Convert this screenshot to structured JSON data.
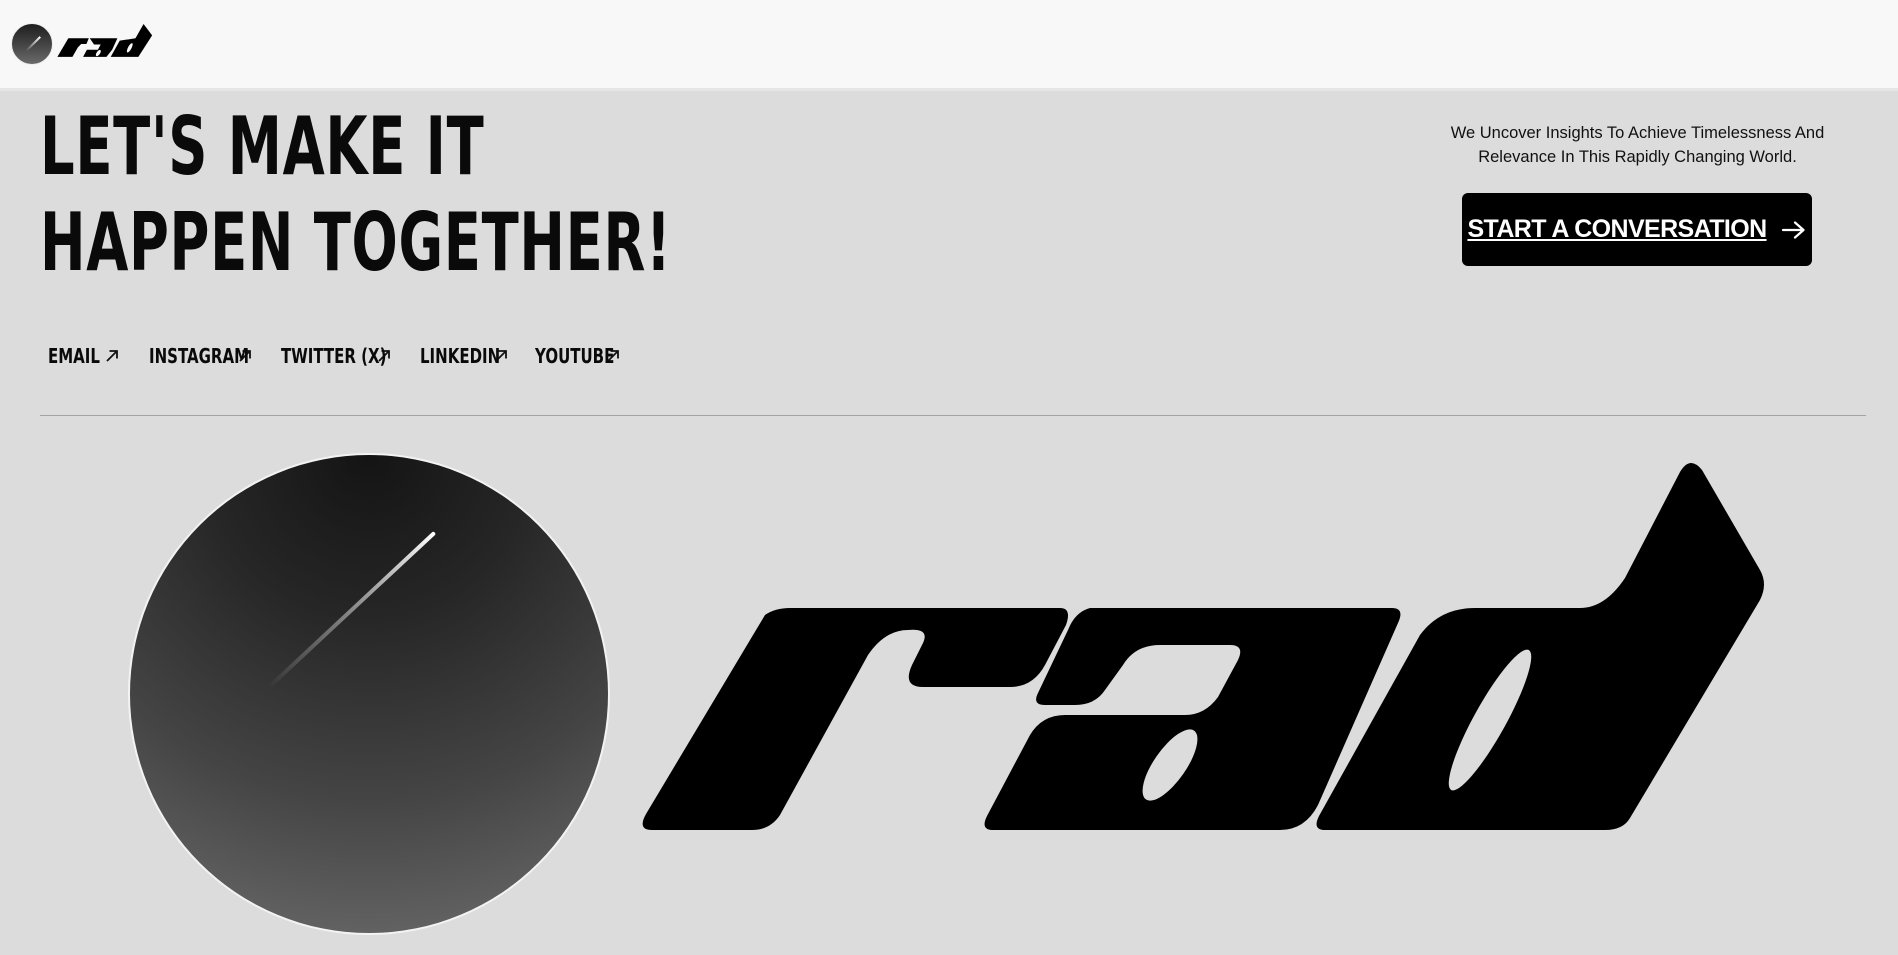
{
  "nav": {
    "brand": "rad"
  },
  "hero": {
    "headline_line1": "LET'S MAKE IT",
    "headline_line2": "HAPPEN TOGETHER!",
    "tagline": "We Uncover Insights To Achieve Timelessness And Relevance In This Rapidly Changing World.",
    "cta_label": "START A CONVERSATION",
    "cta_icon": "arrow-right-icon"
  },
  "social_links": [
    {
      "label": "EMAIL",
      "icon": "arrow-up-right-icon"
    },
    {
      "label": "INSTAGRAM",
      "icon": "arrow-up-right-icon"
    },
    {
      "label": "TWITTER (X)",
      "icon": "arrow-up-right-icon"
    },
    {
      "label": "LINKEDIN",
      "icon": "arrow-up-right-icon"
    },
    {
      "label": "YOUTUBE",
      "icon": "arrow-up-right-icon"
    }
  ],
  "footer_brand": {
    "wordmark": "rad",
    "mark": "orb-logo"
  },
  "colors": {
    "background": "#dcdcdc",
    "header_bg": "#f8f8f8",
    "text": "#0a0a0a",
    "button_bg": "#000000",
    "button_text": "#ffffff",
    "divider": "#a3a3a3"
  }
}
